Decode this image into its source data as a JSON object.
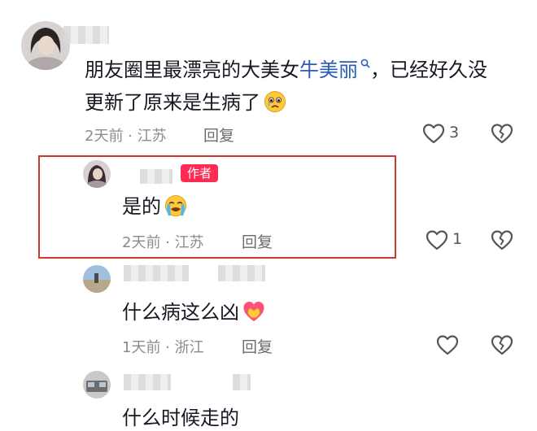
{
  "comments": [
    {
      "text_before": "朋友圈里最漂亮的大美女",
      "mention": "牛美丽",
      "text_after": "，已经好久没",
      "text_line2": "更新了原来是生病了",
      "emoji": "crying-face-emoji",
      "meta": "2天前 · 江苏",
      "reply_label": "回复",
      "like_count": "3"
    },
    {
      "author_tag": "作者",
      "text": "是的",
      "emoji": "loudly-crying-face-emoji",
      "meta": "2天前 · 江苏",
      "reply_label": "回复",
      "like_count": "1"
    },
    {
      "text": "什么病这么凶",
      "emoji": "heart-hands-emoji",
      "meta": "1天前 · 浙江",
      "reply_label": "回复"
    },
    {
      "text": "什么时候走的"
    }
  ],
  "colors": {
    "mention": "#2b5bb5",
    "author_tag": "#fe2c55",
    "highlight_border": "#c83a2e"
  }
}
